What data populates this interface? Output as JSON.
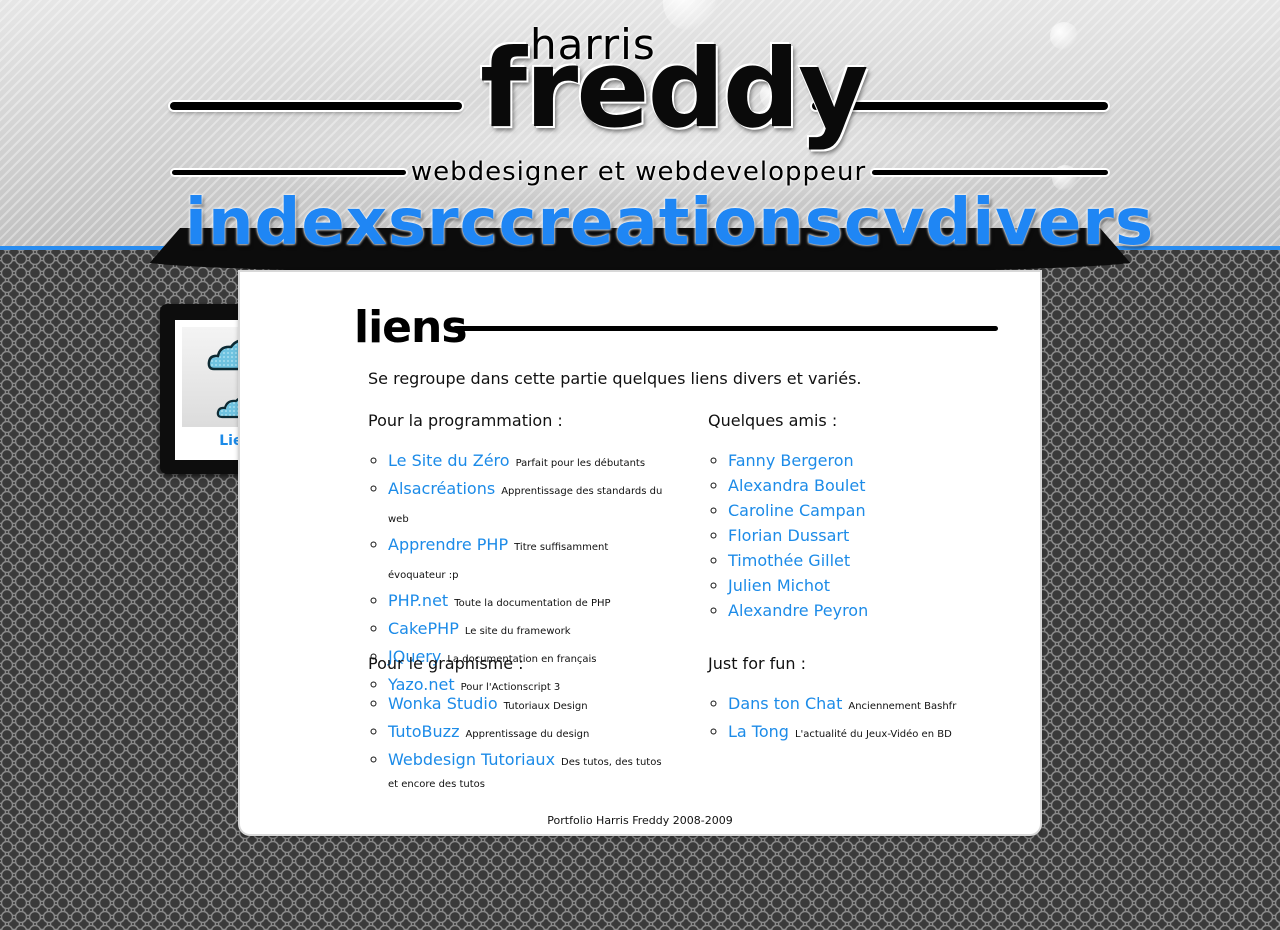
{
  "header": {
    "logo_first_name": "harris",
    "logo_last_name": "freddy",
    "tagline": "webdesigner et webdeveloppeur"
  },
  "nav": {
    "items": [
      {
        "label": "index"
      },
      {
        "label": "src"
      },
      {
        "label": "creations"
      },
      {
        "label": "cv"
      },
      {
        "label": "divers"
      }
    ]
  },
  "sidebar": {
    "thumbnail_icon": "clouds-icon",
    "label": "Liens"
  },
  "main": {
    "title": "liens",
    "intro": "Se regroupe dans cette partie quelques liens divers et variés.",
    "sections": [
      {
        "title": "Pour la programmation :",
        "links": [
          {
            "label": "Le Site du Zéro",
            "desc": "Parfait pour les débutants"
          },
          {
            "label": "Alsacréations",
            "desc": "Apprentissage des standards du web"
          },
          {
            "label": "Apprendre PHP",
            "desc": "Titre suffisamment évoquateur :p"
          },
          {
            "label": "PHP.net",
            "desc": "Toute la documentation de PHP"
          },
          {
            "label": "CakePHP",
            "desc": "Le site du framework"
          },
          {
            "label": "JQuery",
            "desc": "La documentation en français"
          },
          {
            "label": "Yazo.net",
            "desc": "Pour l'Actionscript 3"
          }
        ]
      },
      {
        "title": "Quelques amis :",
        "links": [
          {
            "label": "Fanny Bergeron",
            "desc": ""
          },
          {
            "label": "Alexandra Boulet",
            "desc": ""
          },
          {
            "label": "Caroline Campan",
            "desc": ""
          },
          {
            "label": "Florian Dussart",
            "desc": ""
          },
          {
            "label": "Timothée Gillet",
            "desc": ""
          },
          {
            "label": "Julien Michot",
            "desc": ""
          },
          {
            "label": "Alexandre Peyron",
            "desc": ""
          }
        ]
      },
      {
        "title": "Pour le graphisme :",
        "links": [
          {
            "label": "Wonka Studio",
            "desc": "Tutoriaux Design"
          },
          {
            "label": "TutoBuzz",
            "desc": "Apprentissage du design"
          },
          {
            "label": "Webdesign Tutoriaux",
            "desc": "Des tutos, des tutos et encore des tutos"
          }
        ]
      },
      {
        "title": "Just for fun :",
        "links": [
          {
            "label": "Dans ton Chat",
            "desc": "Anciennement Bashfr"
          },
          {
            "label": "La Tong",
            "desc": "L'actualité du Jeux-Vidéo en BD"
          }
        ]
      }
    ],
    "footer": "Portfolio Harris Freddy 2008-2009"
  },
  "colors": {
    "accent_blue": "#1c8be8",
    "nav_blue": "#1f86f4",
    "header_border": "#2a8df0",
    "background_dark": "#1b1b1b"
  }
}
